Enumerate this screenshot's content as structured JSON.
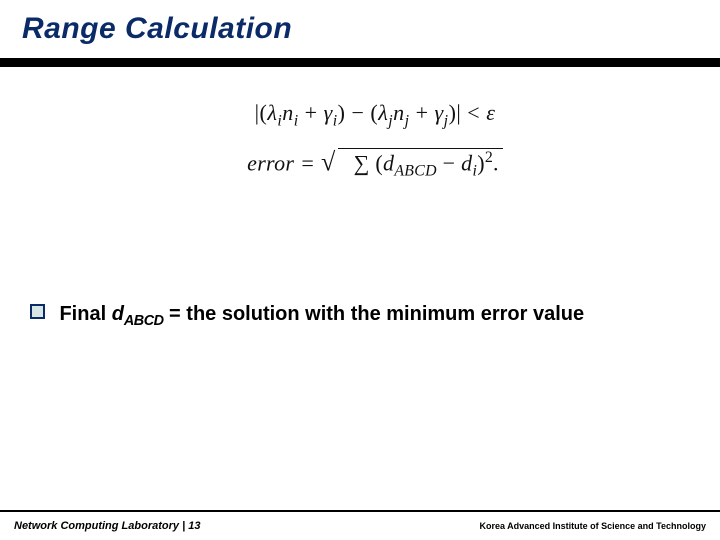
{
  "title": "Range Calculation",
  "equations": {
    "line1_html": "|(<span class='isty'>λ</span><span class='sub'>i</span><span class='isty'>n</span><span class='sub'>i</span> + <span class='isty'>γ</span><span class='sub'>i</span>) − (<span class='isty'>λ</span><span class='sub'>j</span><span class='isty'>n</span><span class='sub'>j</span> + <span class='isty'>γ</span><span class='sub'>j</span>)| &lt; <span class='isty'>ε</span>",
    "line2_prefix": "error = ",
    "line2_radicand_html": "∑ (<span class='isty'>d</span><span class='sub'>ABCD</span> − <span class='isty'>d</span><span class='sub'>i</span>)<span class='subup'>2</span>.",
    "line1_plain": "|(λi ni + γi) − (λj nj + γj)| < ε",
    "line2_plain": "error = √(∑ (d_ABCD − d_i)^2)."
  },
  "bullet": {
    "pre": "Final ",
    "var": "d",
    "var_sub": "ABCD",
    "post": " = the solution with the minimum error value"
  },
  "footer": {
    "left_lab": "Network Computing Laboratory",
    "left_sep": " | ",
    "left_page": "13",
    "right": "Korea Advanced Institute of Science and Technology"
  }
}
